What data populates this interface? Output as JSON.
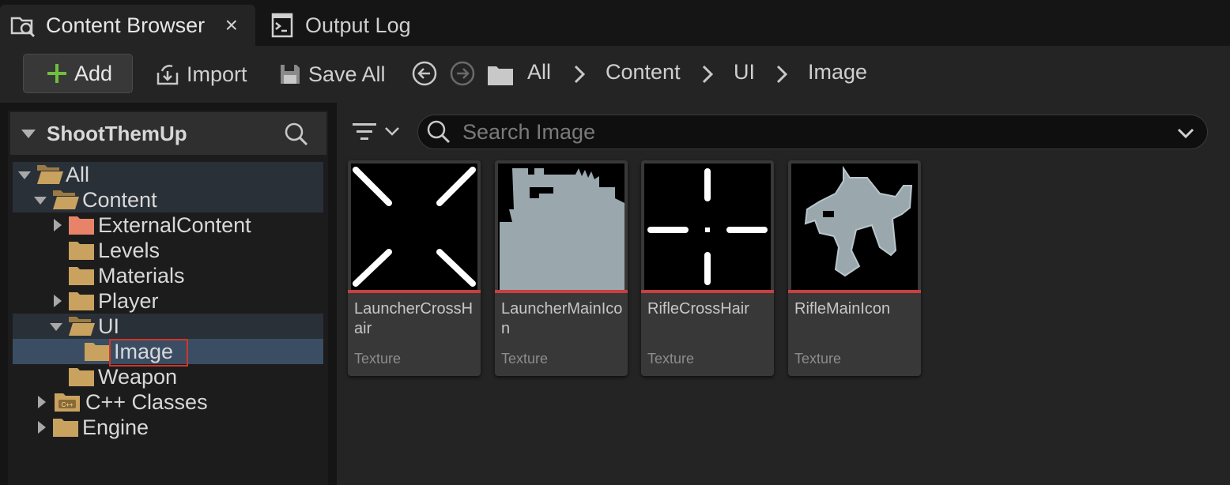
{
  "tabs": {
    "content_browser": {
      "label": "Content Browser",
      "close": "×",
      "icon": "content-browser-icon"
    },
    "output_log": {
      "label": "Output Log",
      "icon": "output-log-icon"
    }
  },
  "toolbar": {
    "add_label": "Add",
    "import_label": "Import",
    "save_all_label": "Save All",
    "breadcrumb": [
      "All",
      "Content",
      "UI",
      "Image"
    ],
    "accent_add": "#6fbf3f"
  },
  "sidebar": {
    "title": "ShootThemUp",
    "tree": [
      {
        "label": "All",
        "expanded": true
      },
      {
        "label": "Content",
        "expanded": true
      },
      {
        "label": "ExternalContent",
        "collapsed": true,
        "color": "#e8836a"
      },
      {
        "label": "Levels"
      },
      {
        "label": "Materials"
      },
      {
        "label": "Player",
        "collapsed": true
      },
      {
        "label": "UI",
        "expanded": true
      },
      {
        "label": "Image",
        "selected": true
      },
      {
        "label": "Weapon"
      },
      {
        "label": "C++ Classes",
        "collapsed": true,
        "badge": "C++"
      },
      {
        "label": "Engine",
        "collapsed": true
      }
    ]
  },
  "search": {
    "placeholder": "Search Image",
    "value": ""
  },
  "assets": [
    {
      "name": "LauncherCrossHair",
      "type": "Texture",
      "thumb": "launcher-crosshair"
    },
    {
      "name": "LauncherMainIcon",
      "type": "Texture",
      "thumb": "launcher-main-icon"
    },
    {
      "name": "RifleCrossHair",
      "type": "Texture",
      "thumb": "rifle-crosshair"
    },
    {
      "name": "RifleMainIcon",
      "type": "Texture",
      "thumb": "rifle-main-icon"
    }
  ],
  "colors": {
    "folder": "#c9a25f",
    "selection": "#3a4d63",
    "asset_bar": "#c7403f",
    "highlight_box": "#d0362a"
  }
}
